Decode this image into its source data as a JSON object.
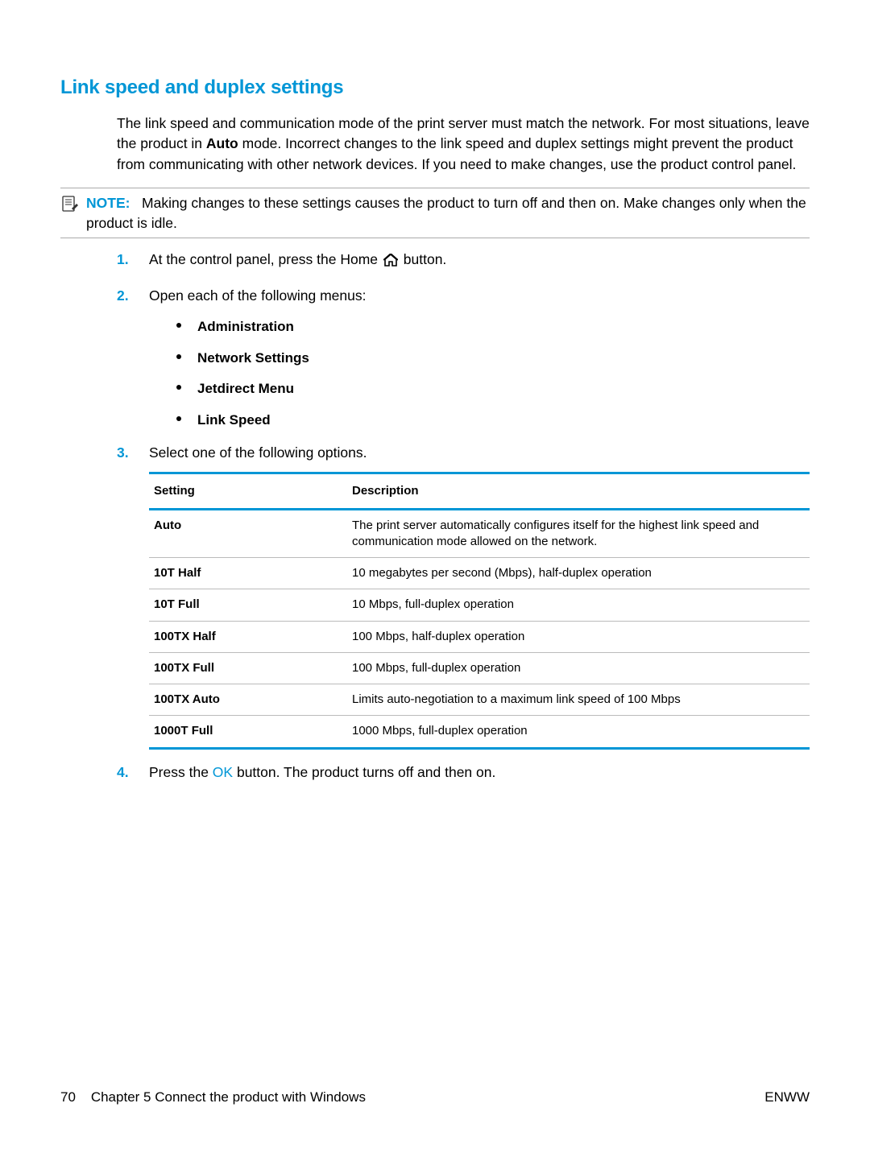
{
  "heading": "Link speed and duplex settings",
  "intro": {
    "pre": "The link speed and communication mode of the print server must match the network. For most situations, leave the product in ",
    "bold": "Auto",
    "post": " mode. Incorrect changes to the link speed and duplex settings might prevent the product from communicating with other network devices. If you need to make changes, use the product control panel."
  },
  "note": {
    "label": "NOTE:",
    "text": "Making changes to these settings causes the product to turn off and then on. Make changes only when the product is idle."
  },
  "steps": {
    "s1a": "At the control panel, press the Home ",
    "s1b": " button.",
    "s2": "Open each of the following menus:",
    "menus": {
      "m1": "Administration",
      "m2": "Network Settings",
      "m3": "Jetdirect Menu",
      "m4": "Link Speed"
    },
    "s3": "Select one of the following options.",
    "s4a": "Press the ",
    "s4ok": "OK",
    "s4b": " button. The product turns off and then on."
  },
  "table": {
    "head": {
      "c1": "Setting",
      "c2": "Description"
    },
    "rows": {
      "r0": {
        "c1": "Auto",
        "c2": "The print server automatically configures itself for the highest link speed and communication mode allowed on the network."
      },
      "r1": {
        "c1": "10T Half",
        "c2": "10 megabytes per second (Mbps), half-duplex operation"
      },
      "r2": {
        "c1": "10T Full",
        "c2": "10 Mbps, full-duplex operation"
      },
      "r3": {
        "c1": "100TX Half",
        "c2": "100 Mbps, half-duplex operation"
      },
      "r4": {
        "c1": "100TX Full",
        "c2": "100 Mbps, full-duplex operation"
      },
      "r5": {
        "c1": "100TX Auto",
        "c2": "Limits auto-negotiation to a maximum link speed of 100 Mbps"
      },
      "r6": {
        "c1": "1000T Full",
        "c2": "1000 Mbps, full-duplex operation"
      }
    }
  },
  "footer": {
    "page": "70",
    "chapter": "Chapter 5   Connect the product with Windows",
    "right": "ENWW"
  }
}
